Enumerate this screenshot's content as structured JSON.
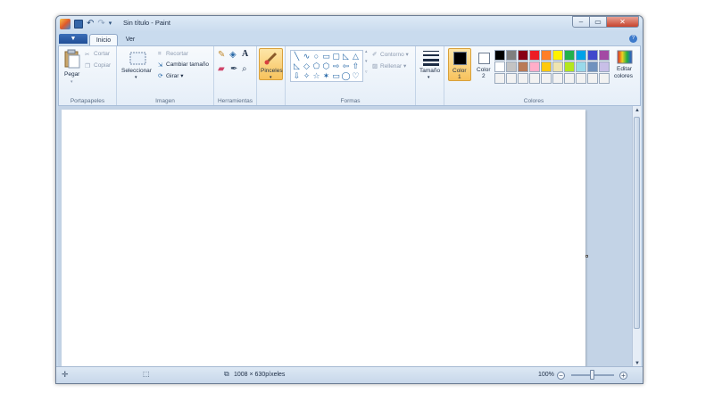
{
  "window": {
    "title": "Sin título - Paint",
    "controls": {
      "minimize": "–",
      "maximize": "▭",
      "close": "✕"
    }
  },
  "tabs": {
    "file_menu": "▼",
    "inicio": "Inicio",
    "ver": "Ver",
    "help": "?"
  },
  "ribbon": {
    "portapapeles": {
      "label": "Portapapeles",
      "pegar": "Pegar",
      "cortar": "Cortar",
      "copiar": "Copiar"
    },
    "imagen": {
      "label": "Imagen",
      "seleccionar": "Seleccionar",
      "recortar": "Recortar",
      "cambiar_tamano": "Cambiar tamaño",
      "girar": "Girar ▾"
    },
    "herramientas": {
      "label": "Herramientas",
      "texto_icon_glyph": "A"
    },
    "pinceles": {
      "label": "Pinceles"
    },
    "formas": {
      "label": "Formas",
      "contorno": "Contorno ▾",
      "rellenar": "Rellenar ▾",
      "shapes": [
        "╲",
        "∿",
        "○",
        "▭",
        "▢",
        "◺",
        "△",
        "◺",
        "◇",
        "⬠",
        "⬡",
        "⇨",
        "⇦",
        "⇧",
        "⇩",
        "✧",
        "☆",
        "✶",
        "▭",
        "◯",
        "♡"
      ]
    },
    "tamano": {
      "label": "Tamaño"
    },
    "color1": {
      "label": "Color",
      "num": "1",
      "value": "#000000"
    },
    "color2": {
      "label": "Color",
      "num": "2",
      "value": "#ffffff"
    },
    "colores": {
      "label": "Colores",
      "editar_line1": "Editar",
      "editar_line2": "colores",
      "palette": [
        "#000000",
        "#7f7f7f",
        "#880015",
        "#ed1c24",
        "#ff7f27",
        "#fff200",
        "#22b14c",
        "#00a2e8",
        "#3f48cc",
        "#a349a4",
        "#ffffff",
        "#c3c3c3",
        "#b97a57",
        "#ffaec9",
        "#ffc90e",
        "#efe4b0",
        "#b5e61d",
        "#99d9ea",
        "#7092be",
        "#c8bfe7",
        "#f2f2f2",
        "#f2f2f2",
        "#f2f2f2",
        "#f2f2f2",
        "#f2f2f2",
        "#f2f2f2",
        "#f2f2f2",
        "#f2f2f2",
        "#f2f2f2",
        "#f2f2f2"
      ]
    }
  },
  "status": {
    "dimensions": "1008 × 630píxeles",
    "zoom": "100%",
    "zoom_out": "−",
    "zoom_in": "+",
    "zoom_level": 0.5
  },
  "scrollbar": {
    "up": "▲",
    "down": "▼"
  }
}
